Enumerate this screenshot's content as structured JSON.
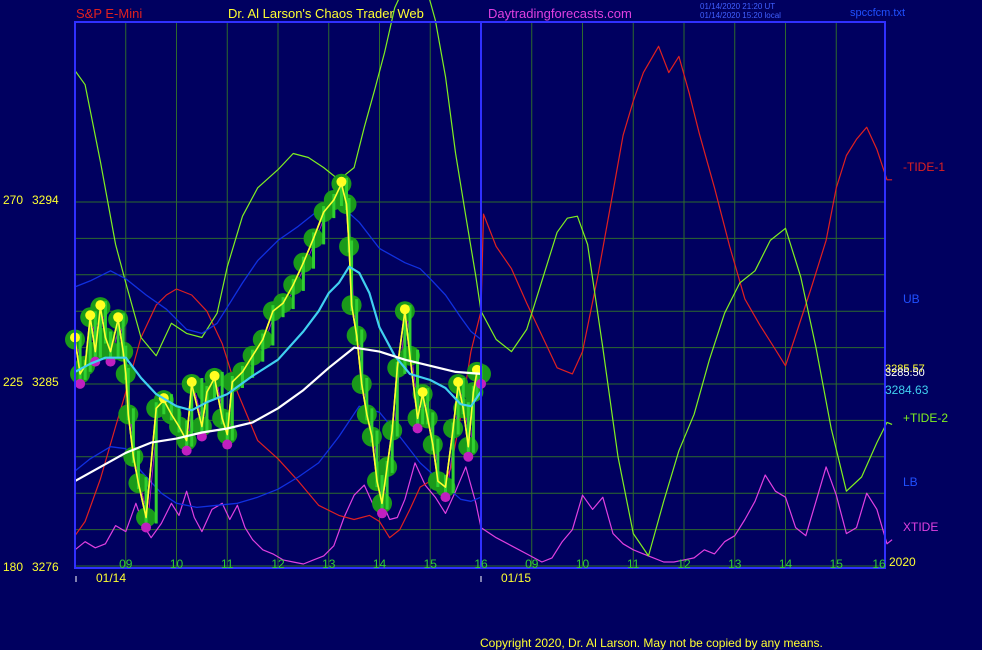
{
  "header": {
    "symbol": "S&P E-Mini",
    "site": "Dr. Al Larson's Chaos Trader Web",
    "url": "Daytradingforecasts.com",
    "timestamp_ut": "01/14/2020 21:20 UT",
    "timestamp_local": "01/14/2020 15:20 local",
    "file": "spccfcm.txt"
  },
  "footer": {
    "copyright": "Copyright 2020, Dr. Al Larson. May not be copied by any means."
  },
  "colors": {
    "background": "#000060",
    "plot_border": "#3030ff",
    "grid": "#2d6a2d",
    "tide1": "#e02020",
    "tide2": "#80f020",
    "xtide": "#e040e0",
    "ub_lb": "#1030e0",
    "price": "#ffff30",
    "ma_fast": "#40d0f0",
    "ma_slow": "#ffffff",
    "markers_green": "#1a9a1a",
    "markers_yellow": "#ffff20",
    "markers_magenta": "#c020c0"
  },
  "chart_data": {
    "type": "line",
    "x_axis": {
      "unit": "hour (Jan 14 then Jan 15, 2020)",
      "range": [
        8,
        17
      ],
      "day1_ticks": [
        "09",
        "10",
        "11",
        "12",
        "13",
        "14",
        "15",
        "16"
      ],
      "day2_ticks": [
        "09",
        "10",
        "11",
        "12",
        "13",
        "14",
        "15",
        "16"
      ],
      "day1_tick_values": [
        9,
        10,
        11,
        12,
        13,
        14,
        15,
        16
      ],
      "day2_tick_values": [
        9,
        10,
        11,
        12,
        13,
        14,
        15,
        16
      ],
      "day1_label": "01/14",
      "day2_label": "01/15",
      "forecast_start": 16.0
    },
    "y_axis": {
      "price_range": [
        3276,
        3295.5
      ],
      "left_ticks": [
        {
          "angle": "180",
          "price": "3276",
          "value": 3276
        },
        {
          "angle": "225",
          "price": "3285",
          "value": 3285
        },
        {
          "angle": "270",
          "price": "3294",
          "value": 3294
        }
      ],
      "grid_values": [
        3276,
        3277.8,
        3279.6,
        3281.4,
        3283.2,
        3285,
        3286.8,
        3288.6,
        3290.4,
        3292.2,
        3294
      ]
    },
    "right_labels": {
      "tide1": "-TIDE-1",
      "ub": "UB",
      "tide2": "+TIDE-2",
      "lb": "LB",
      "xtide": "XTIDE",
      "year": "2020",
      "price_a": "3285.57",
      "price_b": "3285.50",
      "price_c": "3284.63",
      "price_c_value": 3284.63
    },
    "series": [
      {
        "name": "Price",
        "key": "price",
        "day": "01/14",
        "x": [
          8.0,
          8.1,
          8.2,
          8.3,
          8.4,
          8.5,
          8.6,
          8.7,
          8.85,
          8.95,
          9.0,
          9.05,
          9.15,
          9.25,
          9.4,
          9.6,
          9.75,
          9.9,
          10.05,
          10.2,
          10.3,
          10.5,
          10.6,
          10.75,
          10.9,
          11.0,
          11.1,
          11.3,
          11.5,
          11.7,
          11.9,
          12.1,
          12.3,
          12.5,
          12.7,
          12.9,
          13.1,
          13.25,
          13.35,
          13.4,
          13.45,
          13.55,
          13.65,
          13.75,
          13.85,
          13.95,
          14.05,
          14.15,
          14.25,
          14.35,
          14.5,
          14.6,
          14.75,
          14.85,
          14.95,
          15.05,
          15.15,
          15.3,
          15.45,
          15.55,
          15.65,
          15.75,
          15.85,
          15.92,
          16.0
        ],
        "y": [
          3287.2,
          3285.5,
          3285.9,
          3288.3,
          3286.6,
          3288.8,
          3287.3,
          3286.6,
          3288.2,
          3286.6,
          3285.5,
          3283.5,
          3281.4,
          3280.1,
          3278.4,
          3283.8,
          3284.2,
          3283.5,
          3282.9,
          3282.2,
          3285.0,
          3282.9,
          3284.6,
          3285.3,
          3283.3,
          3282.5,
          3285.1,
          3285.6,
          3286.4,
          3287.2,
          3288.6,
          3289.0,
          3289.9,
          3291.0,
          3292.2,
          3293.5,
          3294.1,
          3294.9,
          3293.9,
          3291.8,
          3288.9,
          3287.4,
          3285.0,
          3283.5,
          3282.4,
          3280.2,
          3279.1,
          3280.9,
          3282.7,
          3285.8,
          3288.6,
          3286.4,
          3283.3,
          3284.5,
          3283.3,
          3282.0,
          3280.2,
          3279.9,
          3282.8,
          3285.0,
          3283.8,
          3281.9,
          3284.6,
          3285.6,
          3285.5
        ]
      },
      {
        "name": "MA fast",
        "key": "ma_fast",
        "day": "01/14",
        "x": [
          8.0,
          8.3,
          8.6,
          9.0,
          9.3,
          9.6,
          10.0,
          10.3,
          10.6,
          11.0,
          11.5,
          12.0,
          12.5,
          12.8,
          13.0,
          13.2,
          13.4,
          13.6,
          13.8,
          14.0,
          14.3,
          14.6,
          15.0,
          15.3,
          15.6,
          15.8,
          16.0
        ],
        "y": [
          3285.6,
          3286.0,
          3286.3,
          3286.3,
          3285.3,
          3284.5,
          3283.9,
          3283.7,
          3284.1,
          3284.5,
          3285.4,
          3286.2,
          3287.6,
          3288.6,
          3289.5,
          3290.0,
          3290.8,
          3290.5,
          3289.5,
          3287.8,
          3286.4,
          3285.5,
          3285.2,
          3284.8,
          3284.0,
          3283.9,
          3284.63
        ]
      },
      {
        "name": "MA slow",
        "key": "ma_slow",
        "day": "01/14",
        "x": [
          8.0,
          8.5,
          9.0,
          9.5,
          10.0,
          10.5,
          11.0,
          11.5,
          12.0,
          12.5,
          13.0,
          13.5,
          14.0,
          14.5,
          15.0,
          15.5,
          16.0
        ],
        "y": [
          3280.2,
          3280.9,
          3281.6,
          3282.1,
          3282.3,
          3282.6,
          3282.8,
          3283.1,
          3283.8,
          3284.7,
          3285.8,
          3286.8,
          3286.6,
          3286.2,
          3285.9,
          3285.6,
          3285.5
        ]
      },
      {
        "name": "UB",
        "key": "ub",
        "day": "01/14",
        "x": [
          8.0,
          8.3,
          8.7,
          9.0,
          9.4,
          9.8,
          10.2,
          10.5,
          10.8,
          11.0,
          11.3,
          11.6,
          12.0,
          12.4,
          12.8,
          13.0,
          13.2,
          13.6,
          14.0,
          14.5,
          14.8,
          15.0,
          15.3,
          15.6,
          15.8,
          16.0
        ],
        "y": [
          3289.8,
          3290.1,
          3290.6,
          3290.2,
          3289.4,
          3288.7,
          3287.7,
          3287.5,
          3288.0,
          3288.8,
          3290.0,
          3291.1,
          3292.1,
          3292.8,
          3293.6,
          3294.0,
          3293.9,
          3293.0,
          3291.7,
          3291.0,
          3290.7,
          3290.2,
          3289.4,
          3288.3,
          3287.6,
          3287.2
        ]
      },
      {
        "name": "LB",
        "key": "lb",
        "day": "01/14",
        "x": [
          8.0,
          8.3,
          8.7,
          9.0,
          9.3,
          9.7,
          10.0,
          10.4,
          10.8,
          11.2,
          11.6,
          12.0,
          12.4,
          12.8,
          13.2,
          13.6,
          14.0,
          14.4,
          14.8,
          15.2,
          15.6,
          15.8,
          16.0
        ],
        "y": [
          3280.7,
          3281.3,
          3281.9,
          3281.8,
          3280.7,
          3279.6,
          3279.1,
          3278.9,
          3279.0,
          3279.1,
          3279.4,
          3279.8,
          3280.4,
          3281.1,
          3282.4,
          3283.9,
          3283.6,
          3282.4,
          3281.1,
          3280.2,
          3279.3,
          3279.2,
          3279.4
        ]
      },
      {
        "name": "-TIDE-1",
        "key": "tide1",
        "day": "01/14-01/15",
        "x": [
          8.0,
          8.2,
          8.5,
          8.8,
          9.0,
          9.3,
          9.6,
          9.8,
          10.0,
          10.3,
          10.6,
          10.9,
          11.2,
          11.6,
          12.0,
          12.4,
          12.8,
          13.2,
          13.5,
          13.8,
          14.0,
          14.2,
          14.4,
          14.6,
          14.8,
          15.0,
          15.2,
          15.4,
          15.6,
          15.8,
          16.0,
          16.05,
          16.3,
          16.6,
          16.9,
          17.2,
          17.5,
          17.8,
          18.0,
          18.3,
          18.6,
          18.8,
          19.0,
          19.2,
          19.5,
          19.7,
          19.9,
          20.1,
          20.3,
          20.6,
          20.9,
          21.2,
          21.5,
          21.8,
          22.0,
          22.2,
          22.5,
          22.8,
          23.0,
          23.2,
          23.4,
          23.6,
          23.8,
          24.0,
          24.1
        ],
        "y": [
          3277.5,
          3278.2,
          3280.3,
          3282.9,
          3284.6,
          3287.3,
          3288.9,
          3289.4,
          3289.7,
          3289.4,
          3288.6,
          3287.0,
          3284.6,
          3282.2,
          3281.3,
          3280.2,
          3279.0,
          3278.5,
          3278.3,
          3278.5,
          3278.2,
          3277.4,
          3277.8,
          3278.8,
          3279.9,
          3280.2,
          3279.7,
          3280.8,
          3283.4,
          3286.6,
          3288.6,
          3293.4,
          3291.8,
          3290.7,
          3289.0,
          3287.4,
          3285.8,
          3285.5,
          3286.6,
          3290.3,
          3294.5,
          3297.3,
          3299.0,
          3300.4,
          3301.7,
          3300.4,
          3301.2,
          3299.4,
          3297.4,
          3294.7,
          3291.8,
          3289.2,
          3287.9,
          3286.7,
          3285.9,
          3287.4,
          3289.7,
          3292.1,
          3294.7,
          3296.3,
          3297.1,
          3297.7,
          3296.6,
          3295.1,
          3295.1
        ]
      },
      {
        "name": "+TIDE-2",
        "key": "tide2",
        "day": "01/14-01/15",
        "x": [
          8.0,
          8.2,
          8.5,
          8.8,
          9.0,
          9.3,
          9.6,
          9.9,
          10.2,
          10.5,
          10.8,
          11.0,
          11.3,
          11.6,
          12.0,
          12.3,
          12.6,
          12.9,
          13.2,
          13.5,
          13.7,
          13.9,
          14.1,
          14.3,
          14.5,
          14.7,
          14.9,
          15.1,
          15.3,
          15.5,
          15.7,
          15.9,
          16.0,
          16.3,
          16.6,
          16.9,
          17.2,
          17.5,
          17.7,
          17.9,
          18.1,
          18.4,
          18.7,
          19.0,
          19.3,
          19.6,
          19.9,
          20.2,
          20.5,
          20.8,
          21.1,
          21.4,
          21.7,
          22.0,
          22.3,
          22.6,
          22.9,
          23.2,
          23.5,
          23.8,
          24.0,
          24.1
        ],
        "y": [
          3300.5,
          3299.8,
          3296.0,
          3291.9,
          3290.0,
          3287.3,
          3286.4,
          3288.0,
          3287.5,
          3287.3,
          3288.5,
          3290.8,
          3293.3,
          3294.7,
          3295.6,
          3296.4,
          3296.2,
          3295.7,
          3295.1,
          3295.7,
          3297.7,
          3299.5,
          3301.4,
          3303.6,
          3304.7,
          3305.3,
          3304.8,
          3303.0,
          3300.2,
          3296.4,
          3293.3,
          3290.3,
          3288.6,
          3287.2,
          3286.6,
          3287.7,
          3290.1,
          3292.5,
          3293.2,
          3293.3,
          3291.9,
          3286.8,
          3281.4,
          3277.6,
          3276.5,
          3279.2,
          3281.7,
          3283.5,
          3286.2,
          3288.5,
          3290.0,
          3290.6,
          3292.1,
          3292.7,
          3290.3,
          3286.8,
          3282.8,
          3279.7,
          3280.4,
          3282.1,
          3283.1,
          3283.0
        ]
      },
      {
        "name": "XTIDE",
        "key": "xtide",
        "day": "01/14-01/15",
        "x": [
          8.0,
          8.2,
          8.4,
          8.6,
          8.8,
          9.0,
          9.2,
          9.35,
          9.5,
          9.7,
          9.9,
          10.05,
          10.2,
          10.35,
          10.5,
          10.7,
          10.9,
          11.05,
          11.2,
          11.35,
          11.5,
          11.7,
          11.9,
          12.1,
          12.3,
          12.5,
          12.7,
          12.9,
          13.1,
          13.3,
          13.5,
          13.7,
          13.9,
          14.05,
          14.2,
          14.35,
          14.5,
          14.7,
          14.9,
          15.1,
          15.3,
          15.5,
          15.7,
          15.9,
          16.0,
          16.3,
          16.6,
          16.9,
          17.2,
          17.4,
          17.6,
          17.8,
          18.0,
          18.2,
          18.4,
          18.6,
          18.8,
          19.0,
          19.2,
          19.4,
          19.6,
          19.8,
          20.0,
          20.2,
          20.4,
          20.6,
          20.8,
          21.0,
          21.2,
          21.4,
          21.6,
          21.8,
          22.0,
          22.2,
          22.4,
          22.6,
          22.8,
          23.0,
          23.2,
          23.4,
          23.6,
          23.8,
          24.0,
          24.1
        ],
        "y": [
          3276.8,
          3277.2,
          3276.9,
          3277.1,
          3278.0,
          3277.7,
          3279.1,
          3278.0,
          3277.4,
          3278.1,
          3279.1,
          3278.5,
          3279.7,
          3278.4,
          3277.7,
          3278.8,
          3279.1,
          3278.3,
          3279.0,
          3277.9,
          3277.3,
          3276.8,
          3276.6,
          3276.3,
          3276.2,
          3276.1,
          3276.3,
          3276.5,
          3277.0,
          3278.4,
          3279.5,
          3280.0,
          3278.9,
          3279.2,
          3278.3,
          3278.4,
          3279.3,
          3281.1,
          3280.0,
          3279.4,
          3278.6,
          3279.7,
          3280.9,
          3279.1,
          3277.9,
          3277.4,
          3277.0,
          3276.6,
          3276.2,
          3276.4,
          3277.2,
          3277.8,
          3279.5,
          3278.8,
          3279.4,
          3277.6,
          3277.1,
          3276.8,
          3276.6,
          3276.4,
          3276.2,
          3276.2,
          3276.3,
          3276.4,
          3276.8,
          3276.6,
          3277.2,
          3277.5,
          3278.3,
          3279.2,
          3280.5,
          3279.7,
          3279.4,
          3277.9,
          3277.5,
          3279.2,
          3280.9,
          3279.5,
          3277.6,
          3277.9,
          3279.6,
          3278.8,
          3277.1,
          3277.3
        ]
      }
    ]
  }
}
